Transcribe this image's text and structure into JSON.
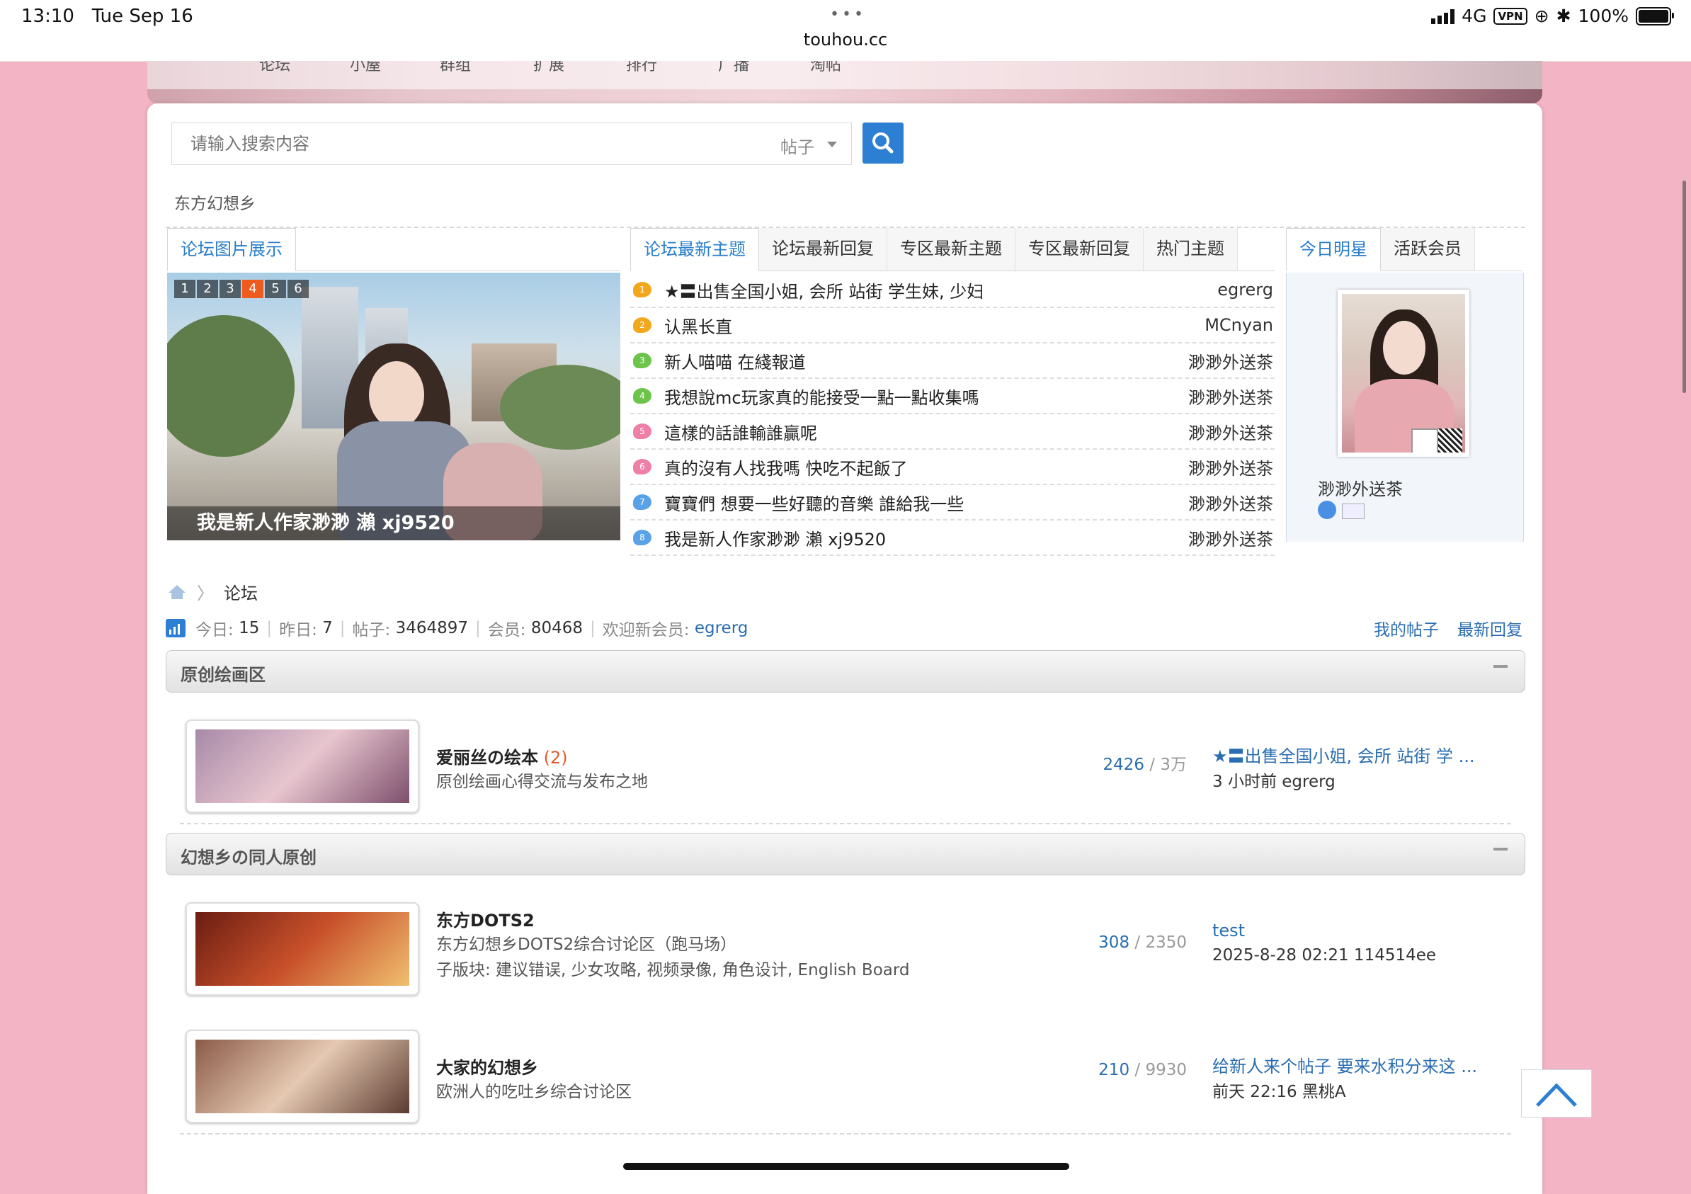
{
  "status_bar": {
    "time": "13:10",
    "date": "Tue Sep 16",
    "dots": "•••",
    "url": "touhou.cc",
    "network": "4G",
    "vpn": "VPN",
    "battery": "100%"
  },
  "top_nav": [
    "论坛",
    "小屋",
    "群组",
    "扩展",
    "排行",
    "广播",
    "淘帖"
  ],
  "search": {
    "placeholder": "请输入搜索内容",
    "type": "帖子"
  },
  "section_title": "东方幻想乡",
  "image_panel": {
    "tab": "论坛图片展示",
    "slides": [
      "1",
      "2",
      "3",
      "4",
      "5",
      "6"
    ],
    "active_slide": "4",
    "caption": "我是新人作家渺渺 瀨 xj9520"
  },
  "threads_panel": {
    "tabs": [
      "论坛最新主题",
      "论坛最新回复",
      "专区最新主题",
      "专区最新回复",
      "热门主题"
    ],
    "threads": [
      {
        "num": "1",
        "color": "#f2a81d",
        "title": "★〓出售全国小姐, 会所 站街 学生妹, 少妇",
        "author": "egrerg"
      },
      {
        "num": "2",
        "color": "#f2a81d",
        "title": "认黑长直",
        "author": "MCnyan"
      },
      {
        "num": "3",
        "color": "#6cc44a",
        "title": "新人喵喵 在綫報道",
        "author": "渺渺外送茶"
      },
      {
        "num": "4",
        "color": "#6cc44a",
        "title": "我想說mc玩家真的能接受一點一點收集嗎",
        "author": "渺渺外送茶"
      },
      {
        "num": "5",
        "color": "#ee7fa6",
        "title": "這樣的話誰輸誰贏呢",
        "author": "渺渺外送茶"
      },
      {
        "num": "6",
        "color": "#ee7fa6",
        "title": "真的沒有人找我嗎 快吃不起飯了",
        "author": "渺渺外送茶"
      },
      {
        "num": "7",
        "color": "#5aa2e6",
        "title": "寶寶們 想要一些好聽的音樂 誰給我一些",
        "author": "渺渺外送茶"
      },
      {
        "num": "8",
        "color": "#5aa2e6",
        "title": "我是新人作家渺渺 瀨 xj9520",
        "author": "渺渺外送茶"
      }
    ]
  },
  "star_panel": {
    "tabs": [
      "今日明星",
      "活跃会员"
    ],
    "name": "渺渺外送茶"
  },
  "breadcrumb": {
    "current": "论坛",
    "separator": "〉"
  },
  "stats": {
    "today_label": "今日:",
    "today": "15",
    "yesterday_label": "昨日:",
    "yesterday": "7",
    "posts_label": "帖子:",
    "posts": "3464897",
    "members_label": "会员:",
    "members": "80468",
    "welcome_label": "欢迎新会员:",
    "newest_member": "egrerg",
    "my_posts": "我的帖子",
    "latest_replies": "最新回复"
  },
  "categories": [
    {
      "title": "原创绘画区",
      "forums": [
        {
          "name": "爱丽丝の绘本",
          "new_count": "(2)",
          "desc": "原创绘画心得交流与发布之地",
          "sub": "",
          "topics": "2426",
          "posts": "3万",
          "last_title": "★〓出售全国小姐, 会所 站街 学 ...",
          "last_meta": "3 小时前 egrerg",
          "thumb_colors": [
            "#a78aa8",
            "#e8c6cf",
            "#7d4f6c"
          ]
        }
      ]
    },
    {
      "title": "幻想乡の同人原创",
      "forums": [
        {
          "name": "东方DOTS2",
          "new_count": "",
          "desc": "东方幻想乡DOTS2综合讨论区（跑马场）",
          "sub": "子版块: 建议错误, 少女攻略, 视频录像, 角色设计, English Board",
          "topics": "308",
          "posts": "2350",
          "last_title": "test",
          "last_meta": "2025-8-28 02:21 114514ee",
          "thumb_colors": [
            "#6b1d12",
            "#c8502a",
            "#f0c070"
          ]
        },
        {
          "name": "大家的幻想乡",
          "new_count": "",
          "desc": "欧洲人的吃吐乡综合讨论区",
          "sub": "",
          "topics": "210",
          "posts": "9930",
          "last_title": "给新人来个帖子 要来水积分来这 ...",
          "last_meta": "前天 22:16 黑桃A",
          "thumb_colors": [
            "#8a5a48",
            "#e6c9b2",
            "#5b3b30"
          ]
        }
      ]
    }
  ]
}
